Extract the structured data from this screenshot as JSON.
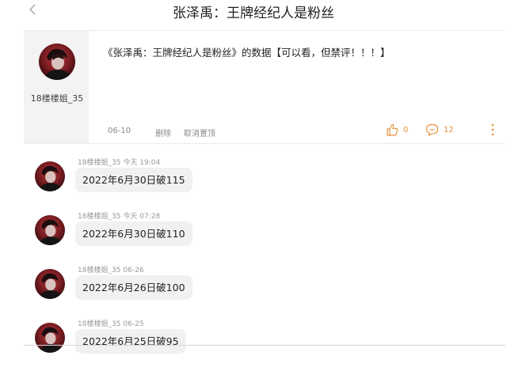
{
  "header": {
    "title": "张泽禹：王牌经纪人是粉丝"
  },
  "post": {
    "author": "18楼楼姐_35",
    "text": "《张泽禹：王牌经纪人是粉丝》的数据【可以看，但禁评！！！】",
    "date": "06-10",
    "delete_label": "删除",
    "unpin_label": "取消置顶",
    "likes": "0",
    "comments": "12"
  },
  "comments": [
    {
      "author": "18楼楼姐_35",
      "time": "今天 19:04",
      "text": "2022年6月30日破115"
    },
    {
      "author": "18楼楼姐_35",
      "time": "今天 07:28",
      "text": "2022年6月30日破110"
    },
    {
      "author": "18楼楼姐_35",
      "time": "06-26",
      "text": "2022年6月26日破100"
    },
    {
      "author": "18楼楼姐_35",
      "time": "06-25",
      "text": "2022年6月25日破95"
    }
  ],
  "colors": {
    "accent": "#e8923a",
    "meta": "#999999",
    "bubble": "#f1f1f1"
  }
}
